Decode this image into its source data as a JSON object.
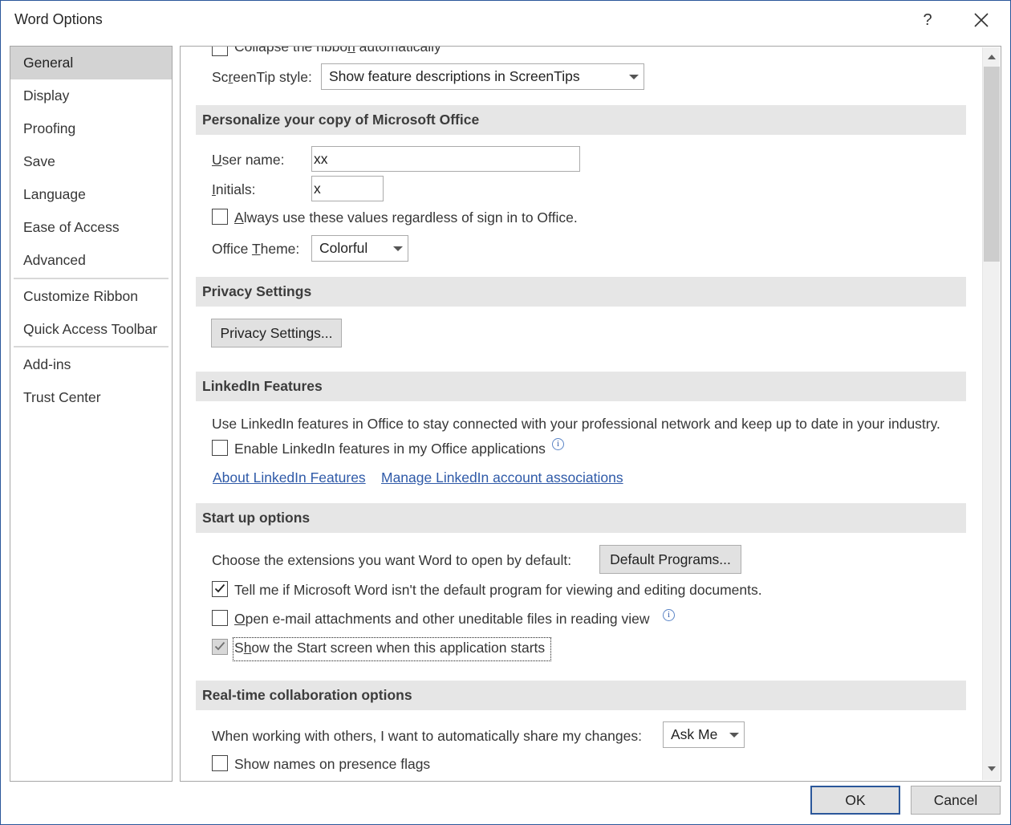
{
  "window": {
    "title": "Word Options",
    "help_label": "?"
  },
  "sidebar": {
    "items": [
      {
        "label": "General",
        "selected": true
      },
      {
        "label": "Display"
      },
      {
        "label": "Proofing"
      },
      {
        "label": "Save"
      },
      {
        "label": "Language"
      },
      {
        "label": "Ease of Access"
      },
      {
        "label": "Advanced"
      },
      {
        "label": "Customize Ribbon"
      },
      {
        "label": "Quick Access Toolbar"
      },
      {
        "label": "Add-ins"
      },
      {
        "label": "Trust Center"
      }
    ]
  },
  "ui_options": {
    "collapse_ribbon": {
      "pre": "Collapse the ribbo",
      "u": "n",
      "post": " automatically",
      "checked": false
    },
    "screentip_label": {
      "pre": "Sc",
      "u": "r",
      "post": "eenTip style:"
    },
    "screentip_value": "Show feature descriptions in ScreenTips"
  },
  "personalize": {
    "heading": "Personalize your copy of Microsoft Office",
    "username_label": {
      "u": "U",
      "post": "ser name:"
    },
    "username_value": "xx",
    "initials_label": {
      "u": "I",
      "post": "nitials:"
    },
    "initials_value": "x",
    "always_use": {
      "u": "A",
      "post": "lways use these values regardless of sign in to Office.",
      "checked": false
    },
    "theme_label": {
      "pre": "Office ",
      "u": "T",
      "post": "heme:"
    },
    "theme_value": "Colorful"
  },
  "privacy": {
    "heading": "Privacy Settings",
    "button": "Privacy Settings..."
  },
  "linkedin": {
    "heading": "LinkedIn Features",
    "description": "Use LinkedIn features in Office to stay connected with your professional network and keep up to date in your industry.",
    "enable": {
      "label": "Enable LinkedIn features in my Office applications",
      "checked": false
    },
    "about_link": "About LinkedIn Features",
    "manage_link": "Manage LinkedIn account associations"
  },
  "startup": {
    "heading": "Start up options",
    "extensions_label": "Choose the extensions you want Word to open by default:",
    "default_programs": "Default Programs...",
    "tell_me": {
      "label": "Tell me if Microsoft Word isn't the default program for viewing and editing documents.",
      "checked": true
    },
    "open_email": {
      "u": "O",
      "post": "pen e-mail attachments and other uneditable files in reading view",
      "checked": false
    },
    "show_start": {
      "pre": "S",
      "u": "h",
      "post": "ow the Start screen when this application starts",
      "checked": true
    }
  },
  "collab": {
    "heading": "Real-time collaboration options",
    "share_label": "When working with others, I want to automatically share my changes:",
    "share_value": "Ask Me",
    "show_names": {
      "label": "Show names on presence flags",
      "checked": false
    }
  },
  "info_icon_glyph": "i",
  "footer": {
    "ok": "OK",
    "cancel": "Cancel"
  }
}
